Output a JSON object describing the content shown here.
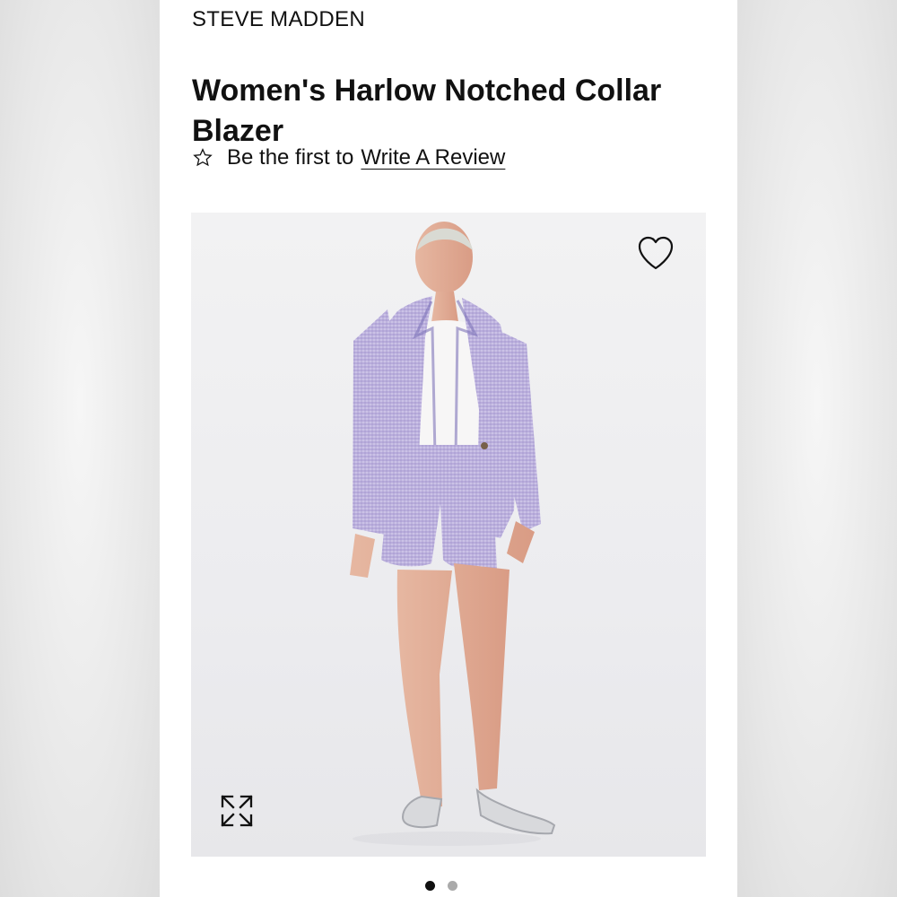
{
  "product": {
    "brand": "STEVE MADDEN",
    "title": "Women's Harlow Notched Collar Blazer",
    "review_prefix": "Be the first to",
    "review_link": "Write A Review"
  },
  "gallery": {
    "image": "model-wearing-lavender-tweed-blazer-and-shorts",
    "pagination": {
      "count": 2,
      "active_index": 1
    }
  },
  "icons": {
    "star": "star-icon",
    "favorite": "heart-icon",
    "expand": "expand-icon"
  },
  "colors": {
    "text": "#111111",
    "lavender": "#b9addc",
    "inactive_dot": "#aaaaaa",
    "active_dot": "#111111"
  }
}
